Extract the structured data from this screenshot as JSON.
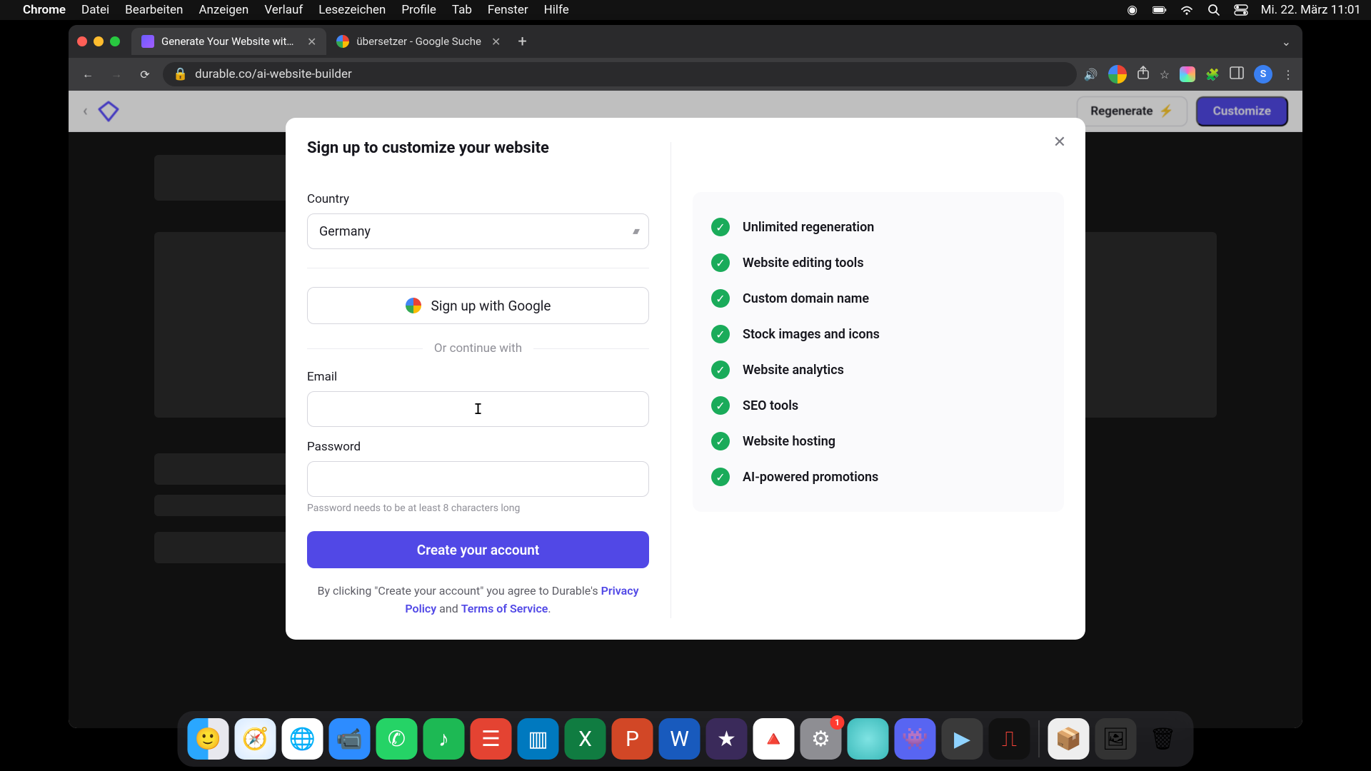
{
  "menubar": {
    "app": "Chrome",
    "items": [
      "Datei",
      "Bearbeiten",
      "Anzeigen",
      "Verlauf",
      "Lesezeichen",
      "Profile",
      "Tab",
      "Fenster",
      "Hilfe"
    ],
    "clock": "Mi. 22. März  11:01"
  },
  "tabs": {
    "active": "Generate Your Website with AI",
    "other": "übersetzer - Google Suche"
  },
  "address": "durable.co/ai-website-builder",
  "app_header": {
    "regenerate": "Regenerate",
    "customize": "Customize"
  },
  "modal": {
    "title": "Sign up to customize your website",
    "country_label": "Country",
    "country_value": "Germany",
    "google_button": "Sign up with Google",
    "or_text": "Or continue with",
    "email_label": "Email",
    "password_label": "Password",
    "password_hint": "Password needs to be at least 8 characters long",
    "submit": "Create your account",
    "legal_prefix": "By clicking \"Create your account\" you agree to Durable's ",
    "privacy": "Privacy Policy",
    "legal_and": " and ",
    "tos": "Terms of Service",
    "legal_suffix": "."
  },
  "features": [
    "Unlimited regeneration",
    "Website editing tools",
    "Custom domain name",
    "Stock images and icons",
    "Website analytics",
    "SEO tools",
    "Website hosting",
    "AI-powered promotions"
  ],
  "dock_badge": "1",
  "profile_initial": "S"
}
